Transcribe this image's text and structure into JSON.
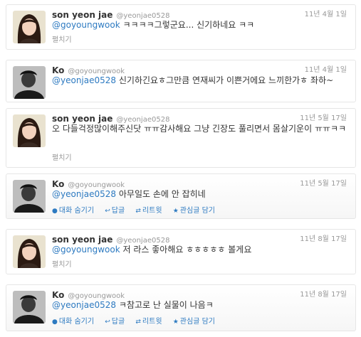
{
  "users": {
    "son": {
      "name": "son yeon jae",
      "handle": "@yeonjae0528"
    },
    "ko": {
      "name": "Ko",
      "handle": "@goyoungwook"
    }
  },
  "actions": {
    "conversation": "대화 숨기기",
    "reply": "답글",
    "retweet": "리트윗",
    "favorite": "관심글 담기",
    "expand": "펼치기"
  },
  "tweets": [
    {
      "mention": "@goyoungwook",
      "text": " ㅋㅋㅋㅋ그렇군요... 신기하네요 ㅋㅋ",
      "date": "11년 4월 1일"
    },
    {
      "mention": "@yeonjae0528",
      "text": " 신기하긴요ㅎ그만큼 연재씨가 이쁜거에요 느끼한가ㅎ 좌하~",
      "date": "11년 4월 1일"
    },
    {
      "mention": "",
      "text": "오 다들걱정많이해주신닷 ㅠㅠ감사해요 그냥 긴장도 풀리면서 몸살기운이 ㅠㅠㅋㅋ",
      "date": "11년 5월 17일"
    },
    {
      "mention": "@yeonjae0528",
      "text": " 아무일도 손에 안 잡히네",
      "date": "11년 5월 17일"
    },
    {
      "mention": "@goyoungwook",
      "text": " 저 라스 좋아해요 ㅎㅎㅎㅎㅎ 볼게요",
      "date": "11년 8월 17일"
    },
    {
      "mention": "@yeonjae0528",
      "text": " ㅋ참고로 난 실물이 나음ㅋ",
      "date": "11년 8월 17일"
    }
  ],
  "colors": {
    "link": "#2d7ac1",
    "meta": "#999999",
    "text": "#333333",
    "border": "#e6e6e6"
  }
}
